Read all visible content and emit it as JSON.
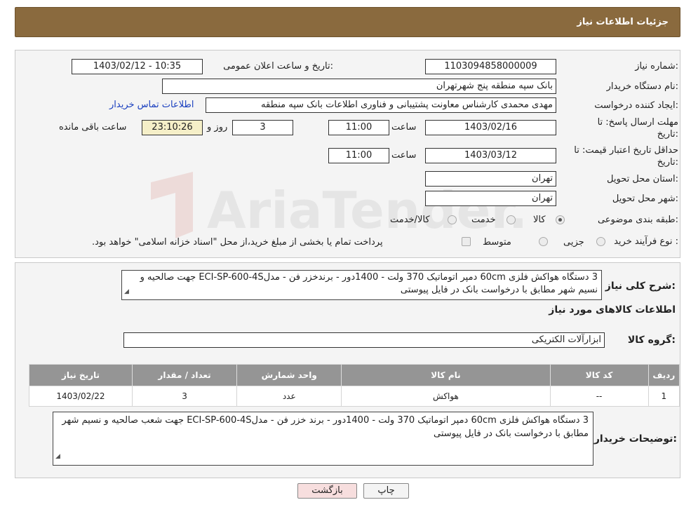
{
  "header": {
    "title": "جزئیات اطلاعات نیاز"
  },
  "form": {
    "need_number": {
      "label": "شماره نیاز:",
      "value": "1103094858000009"
    },
    "announce_datetime": {
      "label": "تاریخ و ساعت اعلان عمومی:",
      "value": "1403/02/12 - 10:35"
    },
    "buyer_org": {
      "label": "نام دستگاه خریدار:",
      "value": "بانک سپه منطقه پنج شهرتهران"
    },
    "requester": {
      "label": "ایجاد کننده درخواست:",
      "value": "مهدی محمدی کارشناس معاونت پشتیبانی و فناوری اطلاعات بانک سپه منطقه",
      "contact_link": "اطلاعات تماس خریدار"
    },
    "deadline": {
      "label_line1": "مهلت ارسال پاسخ: تا",
      "label_line2": "تاریخ:",
      "date": "1403/02/16",
      "time_label": "ساعت",
      "time": "11:00",
      "days": "3",
      "days_label": "روز و",
      "remaining": "23:10:26",
      "remaining_label": "ساعت باقی مانده"
    },
    "validity": {
      "label_line1": "حداقل تاریخ اعتبار قیمت: تا",
      "label_line2": "تاریخ:",
      "date": "1403/03/12",
      "time_label": "ساعت",
      "time": "11:00"
    },
    "province": {
      "label": "استان محل تحویل:",
      "value": "تهران"
    },
    "city": {
      "label": "شهر محل تحویل:",
      "value": "تهران"
    },
    "category": {
      "label": "طبقه بندی موضوعی:",
      "options": [
        "کالا",
        "خدمت",
        "کالا/خدمت"
      ],
      "selected": "کالا"
    },
    "purchase_type": {
      "label": "نوع فرآیند خرید :",
      "options": [
        "جزیی",
        "متوسط"
      ],
      "note": "پرداخت تمام یا بخشی از مبلغ خرید،از محل \"اسناد خزانه اسلامی\" خواهد بود."
    }
  },
  "summary": {
    "label": "شرح کلی نیاز:",
    "text": "3 دستگاه هواکش فلزی 60cm دمپر اتوماتیک 370 ولت - 1400دور - برندخزر فن - مدلECI-SP-600-4S جهت صالحیه و نسیم شهر مطابق با درخواست بانک در فایل پیوستی"
  },
  "goods_section": {
    "title": "اطلاعات کالاهای مورد نیاز"
  },
  "goods_group": {
    "label": "گروه کالا:",
    "value": "ابزارآلات الکتریکی"
  },
  "table": {
    "headers": [
      "ردیف",
      "کد کالا",
      "نام کالا",
      "واحد شمارش",
      "تعداد / مقدار",
      "تاریخ نیاز"
    ],
    "rows": [
      [
        "1",
        "--",
        "هواکش",
        "عدد",
        "3",
        "1403/02/22"
      ]
    ]
  },
  "buyer_notes": {
    "label": "توضیحات خریدار:",
    "text": "3 دستگاه هواکش فلزی 60cm دمپر اتوماتیک 370 ولت - 1400دور - برند خزر فن - مدلECI-SP-600-4S  جهت شعب صالحیه و نسیم شهر مطابق با درخواست بانک در فایل پیوستی"
  },
  "buttons": {
    "print": "چاپ",
    "back": "بازگشت"
  },
  "watermark": {
    "text": "AriaTender.neT"
  },
  "colors": {
    "header_bg": "#8a6a3e",
    "table_header_bg": "#959595",
    "link": "#1a3fbf",
    "back_button_bg": "#f7dede"
  }
}
